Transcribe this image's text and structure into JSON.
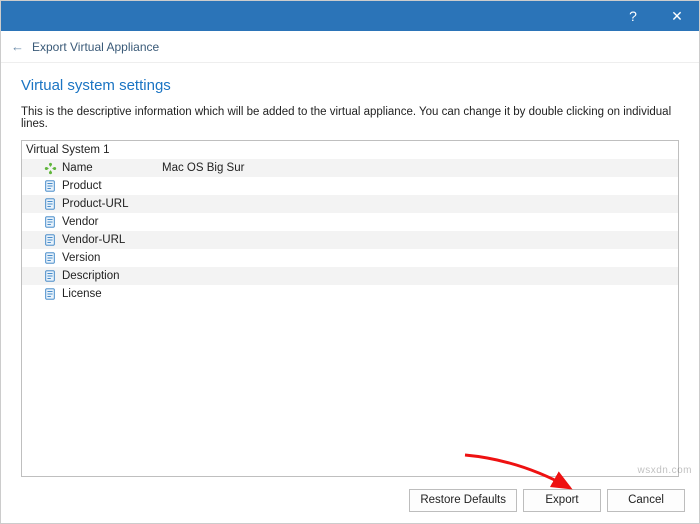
{
  "titlebar": {
    "help": "?",
    "close": "✕"
  },
  "subheader": {
    "back_glyph": "←",
    "title": "Export Virtual Appliance"
  },
  "heading": "Virtual system settings",
  "description": "This is the descriptive information which will be added to the virtual appliance. You can change it by double clicking on individual lines.",
  "system": {
    "title": "Virtual System 1",
    "props": {
      "name": {
        "label": "Name",
        "value": "Mac OS Big Sur"
      },
      "product": {
        "label": "Product",
        "value": ""
      },
      "product_url": {
        "label": "Product-URL",
        "value": ""
      },
      "vendor": {
        "label": "Vendor",
        "value": ""
      },
      "vendor_url": {
        "label": "Vendor-URL",
        "value": ""
      },
      "version": {
        "label": "Version",
        "value": ""
      },
      "description": {
        "label": "Description",
        "value": ""
      },
      "license": {
        "label": "License",
        "value": ""
      }
    }
  },
  "buttons": {
    "restore": "Restore Defaults",
    "export": "Export",
    "cancel": "Cancel"
  },
  "watermark": "wsxdn.com"
}
